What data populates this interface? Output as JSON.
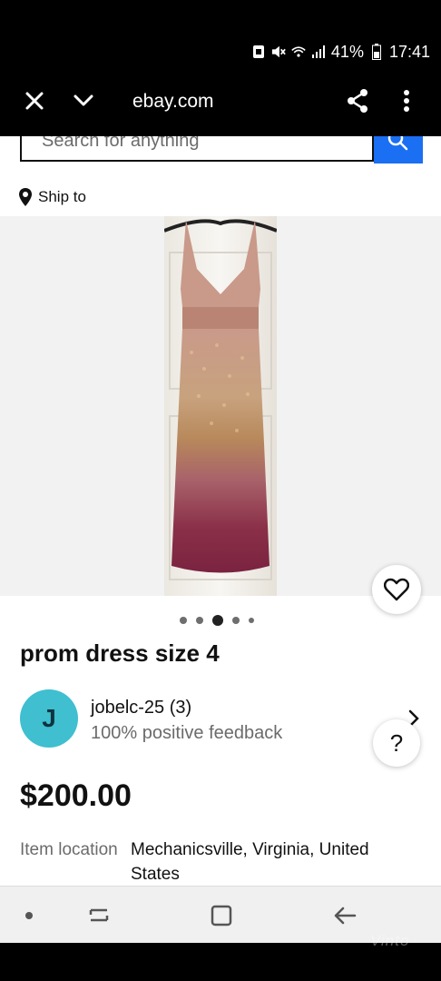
{
  "status_bar": {
    "battery": "41%",
    "time": "17:41"
  },
  "browser": {
    "url": "ebay.com"
  },
  "search": {
    "placeholder": "Search for anything"
  },
  "shipping": {
    "label": "Ship to"
  },
  "product": {
    "title": "prom dress size 4",
    "price": "$200.00",
    "gallery": {
      "total_images": 5,
      "active_index": 3
    }
  },
  "seller": {
    "initial": "J",
    "name": "jobelc-25 (3)",
    "feedback": "100% positive feedback"
  },
  "details": {
    "item_location_label": "Item location",
    "item_location_value": "Mechanicsville, Virginia, United States"
  },
  "help": {
    "label": "?"
  },
  "watermark": {
    "text": "Vinto"
  },
  "colors": {
    "accent": "#1b6ff2",
    "avatar": "#3fbfcf",
    "system_bar": "#000000"
  },
  "icons": {
    "close": "close-icon",
    "dropdown": "chevron-down-icon",
    "share": "share-icon",
    "more": "more-vertical-icon",
    "search": "search-icon",
    "location": "location-pin-icon",
    "favorite": "heart-icon",
    "chevron": "chevron-right-icon",
    "home": "home-icon",
    "back": "back-icon"
  }
}
